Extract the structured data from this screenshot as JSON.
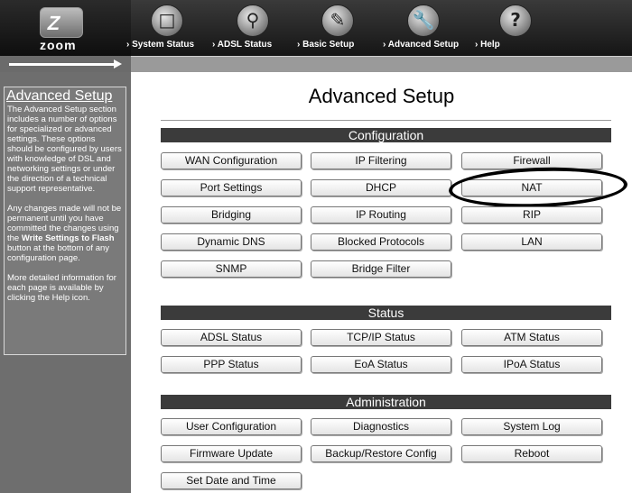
{
  "header": {
    "logo_text": "zoom",
    "logo_mark": "Z",
    "nav": [
      {
        "label": "System Status",
        "icon": "folder-icon"
      },
      {
        "label": "ADSL Status",
        "icon": "magnifier-icon"
      },
      {
        "label": "Basic Setup",
        "icon": "pen-icon"
      },
      {
        "label": "Advanced Setup",
        "icon": "wrench-icon"
      },
      {
        "label": "Help",
        "icon": "question-icon"
      }
    ]
  },
  "sidebar": {
    "title": "Advanced Setup",
    "para1": "The Advanced Setup section includes a number of options for specialized or advanced settings. These options should be configured by users with knowledge of DSL and networking settings or under the direction of a technical support representative.",
    "para2_a": "Any changes made will not be permanent until you have committed the changes using the ",
    "para2_bold": "Write Settings to Flash",
    "para2_b": " button at the bottom of any configuration page.",
    "para3": "More detailed information for each page is available by clicking the Help icon."
  },
  "main": {
    "title": "Advanced Setup",
    "sections": [
      {
        "title": "Configuration",
        "buttons": [
          "WAN Configuration",
          "IP Filtering",
          "Firewall",
          "Port Settings",
          "DHCP",
          "NAT",
          "Bridging",
          "IP Routing",
          "RIP",
          "Dynamic DNS",
          "Blocked Protocols",
          "LAN",
          "SNMP",
          "Bridge Filter"
        ]
      },
      {
        "title": "Status",
        "buttons": [
          "ADSL Status",
          "TCP/IP Status",
          "ATM Status",
          "PPP Status",
          "EoA Status",
          "IPoA Status"
        ]
      },
      {
        "title": "Administration",
        "buttons": [
          "User Configuration",
          "Diagnostics",
          "System Log",
          "Firmware Update",
          "Backup/Restore Config",
          "Reboot",
          "Set Date and Time"
        ]
      }
    ]
  }
}
